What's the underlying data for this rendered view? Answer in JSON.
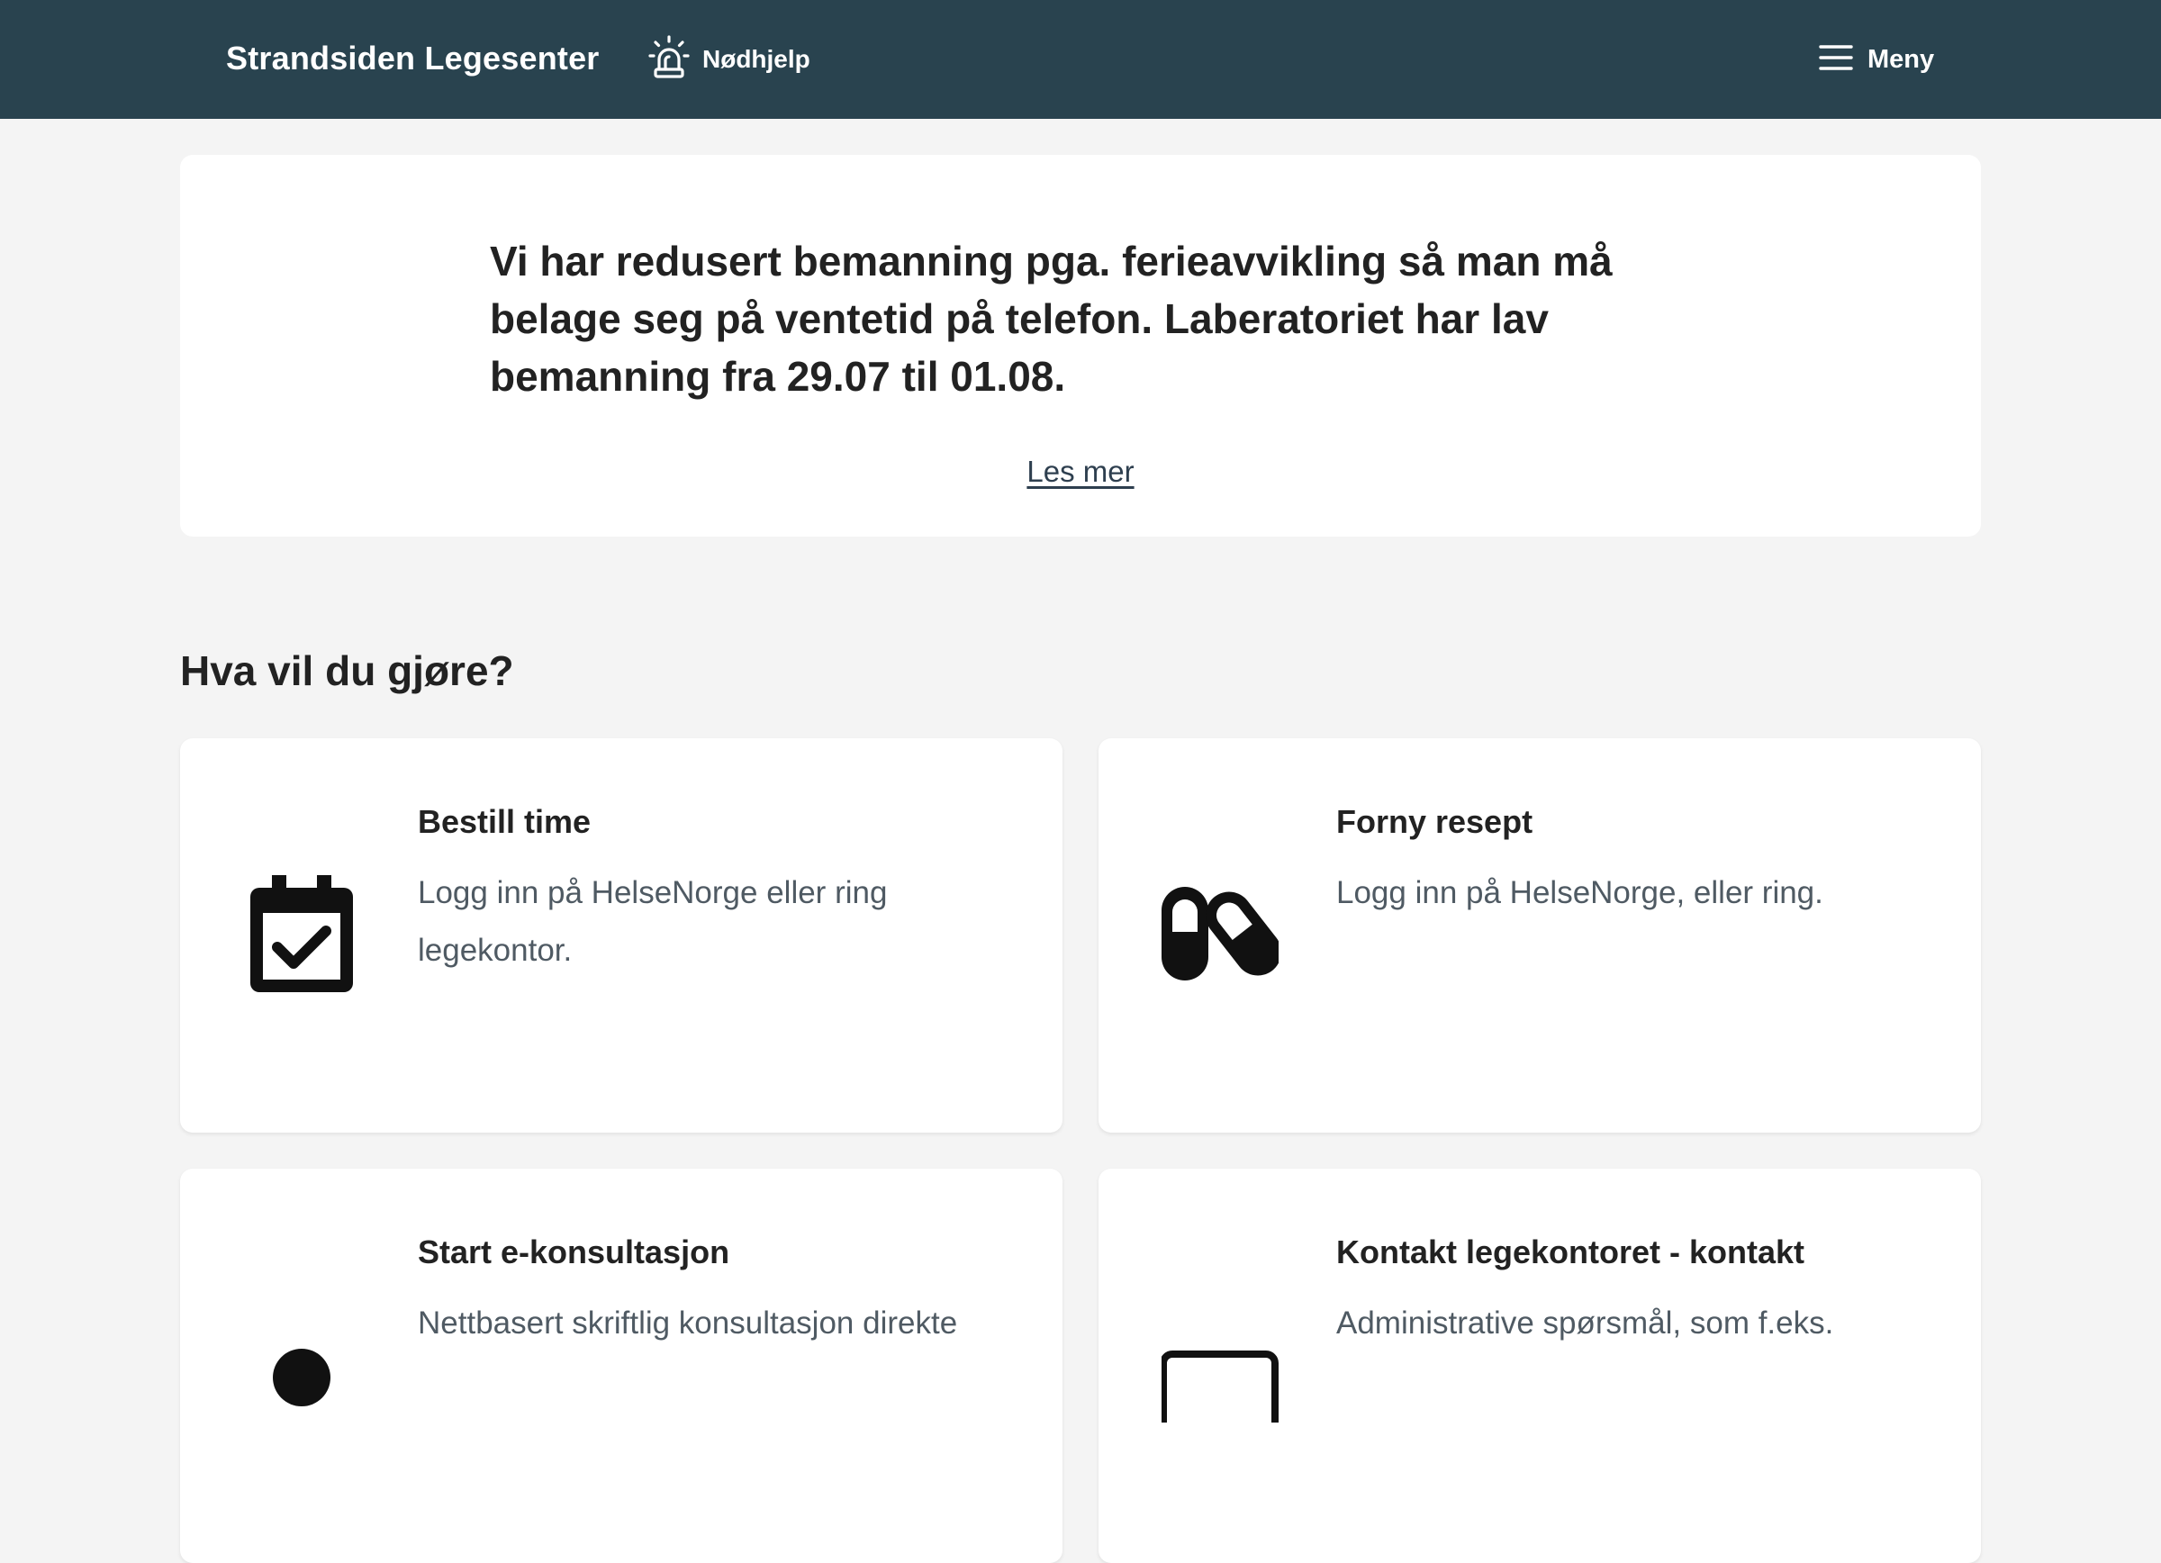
{
  "header": {
    "brand": "Strandsiden Legesenter",
    "emergency_label": "Nødhjelp",
    "emergency_icon": "siren-icon",
    "menu_label": "Meny",
    "menu_icon": "hamburger-icon",
    "background_color": "#29434f"
  },
  "notice": {
    "text": "Vi har redusert bemanning pga. ferieavvikling så man må belage seg på ventetid på telefon. Laberatoriet har lav bemanning fra 29.07 til 01.08.",
    "link_label": "Les mer"
  },
  "actions": {
    "heading": "Hva vil du gjøre?",
    "cards": [
      {
        "title": "Bestill time",
        "description": "Logg inn på HelseNorge eller ring legekontor.",
        "icon": "calendar-check-icon"
      },
      {
        "title": "Forny resept",
        "description": "Logg inn på HelseNorge, eller ring.",
        "icon": "pills-icon"
      },
      {
        "title": "Start e-konsultasjon",
        "description": "Nettbasert skriftlig konsultasjon direkte",
        "icon": "person-icon"
      },
      {
        "title": "Kontakt legekontoret - kontakt",
        "description": "Administrative spørsmål, som f.eks.",
        "icon": "message-icon"
      }
    ]
  }
}
